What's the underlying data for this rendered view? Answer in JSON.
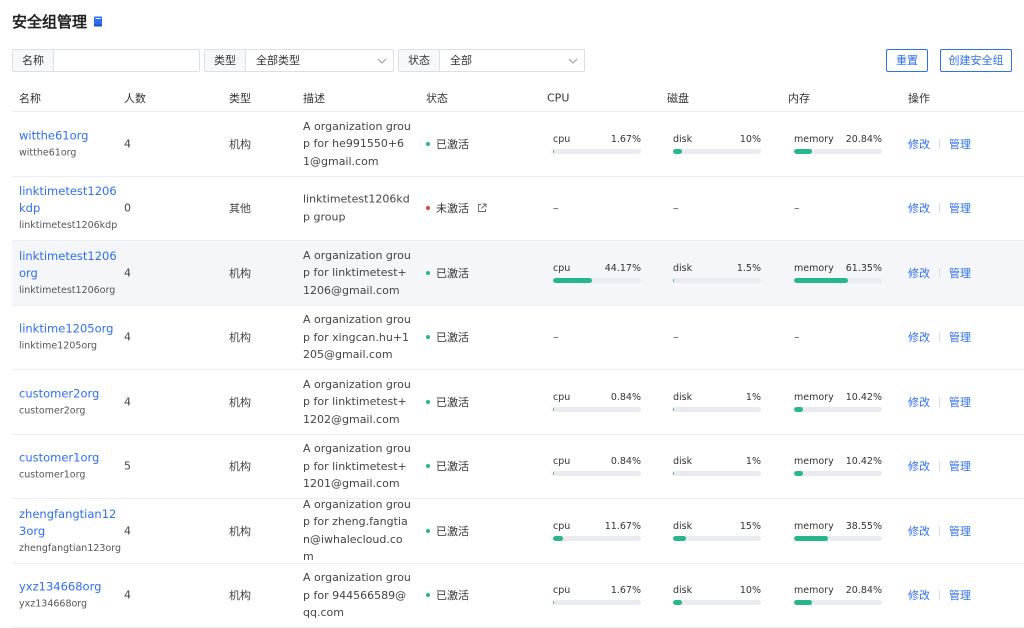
{
  "page": {
    "title": "安全组管理",
    "title_icon": "book-icon"
  },
  "filters": {
    "name_label": "名称",
    "name_value": "",
    "type_label": "类型",
    "type_value": "全部类型",
    "status_label": "状态",
    "status_value": "全部"
  },
  "buttons": {
    "reset": "重置",
    "create": "创建安全组"
  },
  "columns": [
    "名称",
    "人数",
    "类型",
    "描述",
    "状态",
    "CPU",
    "磁盘",
    "内存",
    "操作"
  ],
  "colors": {
    "link": "#2f6ff5",
    "active": "#27b78e",
    "inactive": "#e04a4a",
    "bar": "#27b78e"
  },
  "rows": [
    {
      "name": "witthe61org",
      "sub": "witthe61org",
      "count": "4",
      "type": "机构",
      "desc": "A organization group for he991550+61@gmail.com",
      "status": "已激活",
      "active": true,
      "cpu": {
        "label": "cpu",
        "value": "1.67%",
        "pct": 1.67
      },
      "disk": {
        "label": "disk",
        "value": "10%",
        "pct": 10
      },
      "memory": {
        "label": "memory",
        "value": "20.84%",
        "pct": 20.84
      },
      "op_edit": "修改",
      "op_manage": "管理"
    },
    {
      "name": "linktimetest1206kdp",
      "sub": "linktimetest1206kdp",
      "count": "0",
      "type": "其他",
      "desc": "linktimetest1206kdp group",
      "status": "未激活",
      "active": false,
      "cpu": null,
      "disk": null,
      "memory": null,
      "dash": "–",
      "op_edit": "修改",
      "op_manage": "管理"
    },
    {
      "name": "linktimetest1206org",
      "sub": "linktimetest1206org",
      "count": "4",
      "type": "机构",
      "desc": "A organization group for linktimetest+1206@gmail.com",
      "status": "已激活",
      "active": true,
      "cpu": {
        "label": "cpu",
        "value": "44.17%",
        "pct": 44.17
      },
      "disk": {
        "label": "disk",
        "value": "1.5%",
        "pct": 1.5
      },
      "memory": {
        "label": "memory",
        "value": "61.35%",
        "pct": 61.35
      },
      "op_edit": "修改",
      "op_manage": "管理"
    },
    {
      "name": "linktime1205org",
      "sub": "linktime1205org",
      "count": "4",
      "type": "机构",
      "desc": "A organization group for xingcan.hu+1205@gmail.com",
      "status": "已激活",
      "active": true,
      "cpu": null,
      "disk": null,
      "memory": null,
      "dash": "–",
      "op_edit": "修改",
      "op_manage": "管理"
    },
    {
      "name": "customer2org",
      "sub": "customer2org",
      "count": "4",
      "type": "机构",
      "desc": "A organization group for linktimetest+1202@gmail.com",
      "status": "已激活",
      "active": true,
      "cpu": {
        "label": "cpu",
        "value": "0.84%",
        "pct": 0.84
      },
      "disk": {
        "label": "disk",
        "value": "1%",
        "pct": 1
      },
      "memory": {
        "label": "memory",
        "value": "10.42%",
        "pct": 10.42
      },
      "op_edit": "修改",
      "op_manage": "管理"
    },
    {
      "name": "customer1org",
      "sub": "customer1org",
      "count": "5",
      "type": "机构",
      "desc": "A organization group for linktimetest+1201@gmail.com",
      "status": "已激活",
      "active": true,
      "cpu": {
        "label": "cpu",
        "value": "0.84%",
        "pct": 0.84
      },
      "disk": {
        "label": "disk",
        "value": "1%",
        "pct": 1
      },
      "memory": {
        "label": "memory",
        "value": "10.42%",
        "pct": 10.42
      },
      "op_edit": "修改",
      "op_manage": "管理"
    },
    {
      "name": "zhengfangtian123org",
      "sub": "zhengfangtian123org",
      "count": "4",
      "type": "机构",
      "desc": "A organization group for zheng.fangtian@iwhalecloud.com",
      "status": "已激活",
      "active": true,
      "cpu": {
        "label": "cpu",
        "value": "11.67%",
        "pct": 11.67
      },
      "disk": {
        "label": "disk",
        "value": "15%",
        "pct": 15
      },
      "memory": {
        "label": "memory",
        "value": "38.55%",
        "pct": 38.55
      },
      "op_edit": "修改",
      "op_manage": "管理"
    },
    {
      "name": "yxz134668org",
      "sub": "yxz134668org",
      "count": "4",
      "type": "机构",
      "desc": "A organization group for 944566589@qq.com",
      "status": "已激活",
      "active": true,
      "cpu": {
        "label": "cpu",
        "value": "1.67%",
        "pct": 1.67
      },
      "disk": {
        "label": "disk",
        "value": "10%",
        "pct": 10
      },
      "memory": {
        "label": "memory",
        "value": "20.84%",
        "pct": 20.84
      },
      "op_edit": "修改",
      "op_manage": "管理"
    }
  ]
}
